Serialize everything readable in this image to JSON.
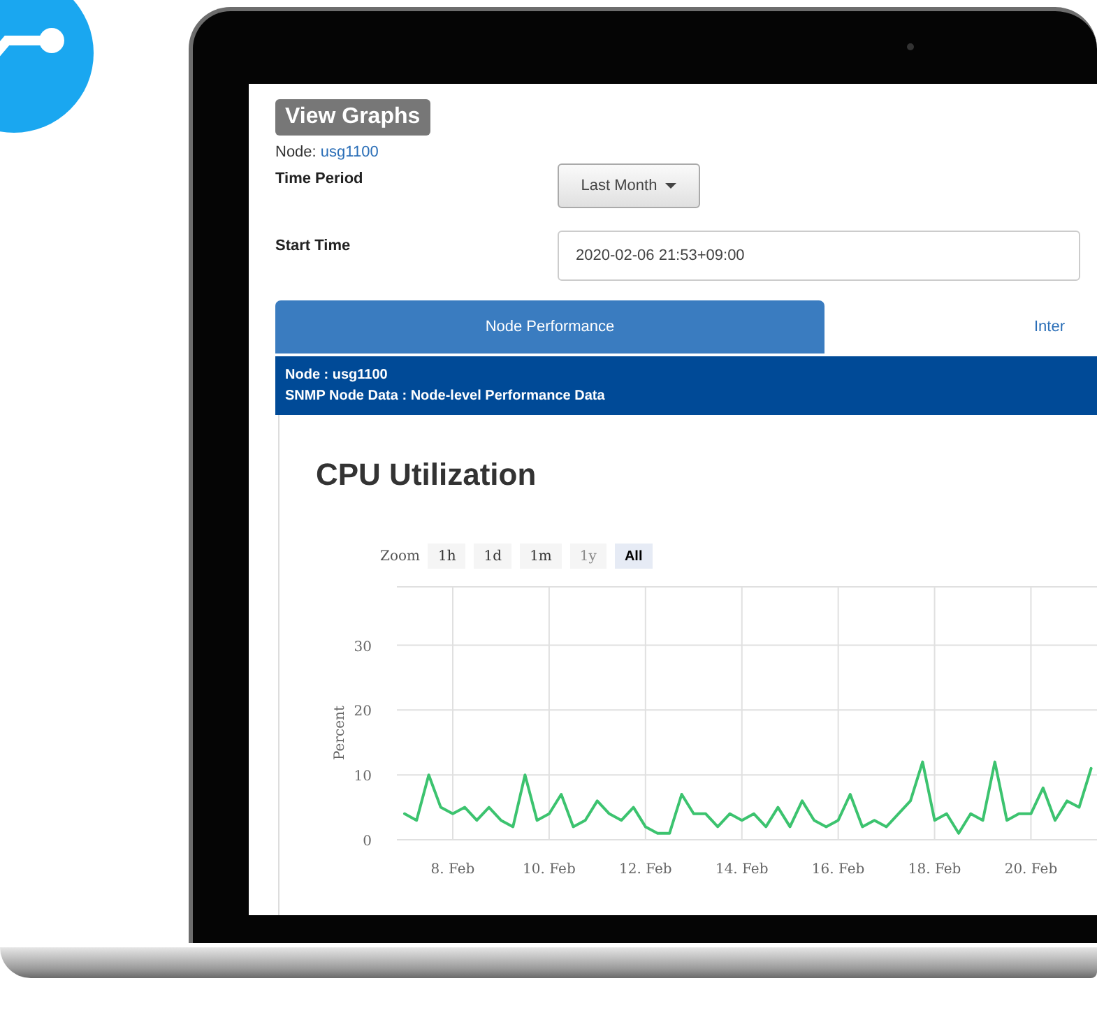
{
  "page": {
    "heading": "View Graphs",
    "node_label": "Node:",
    "node_link": "usg1100"
  },
  "form": [
    {
      "label": "Time Period",
      "kind": "dropdown",
      "value": "Last Month"
    },
    {
      "label": "Start Time",
      "kind": "text",
      "value": "2020-02-06 21:53+09:00"
    }
  ],
  "tabs": [
    {
      "label": "Node Performance",
      "selected": true
    },
    {
      "label": "Inter",
      "selected": false
    }
  ],
  "panel": {
    "lines": [
      "Node : usg1100",
      "SNMP Node Data : Node-level Performance Data"
    ]
  },
  "chart": {
    "zoom_label": "Zoom",
    "zoom_buttons": [
      {
        "label": "1h",
        "selected": false,
        "disabled": false
      },
      {
        "label": "1d",
        "selected": false,
        "disabled": false
      },
      {
        "label": "1m",
        "selected": false,
        "disabled": false
      },
      {
        "label": "1y",
        "selected": false,
        "disabled": true
      },
      {
        "label": "All",
        "selected": true,
        "disabled": false
      }
    ],
    "chart_data": {
      "type": "line",
      "title": "CPU Utilization",
      "ylabel": "Percent",
      "grid": true,
      "ylim": [
        0,
        39
      ],
      "yticks": [
        0,
        10,
        20,
        30
      ],
      "categories": [
        null,
        null,
        null,
        null,
        "8. Feb",
        null,
        null,
        null,
        null,
        null,
        null,
        null,
        "10. Feb",
        null,
        null,
        null,
        null,
        null,
        null,
        null,
        "12. Feb",
        null,
        null,
        null,
        null,
        null,
        null,
        null,
        "14. Feb",
        null,
        null,
        null,
        null,
        null,
        null,
        null,
        "16. Feb",
        null,
        null,
        null,
        null,
        null,
        null,
        null,
        "18. Feb",
        null,
        null,
        null,
        null,
        null,
        null,
        null,
        "20. Feb",
        null,
        null,
        null,
        null,
        null
      ],
      "series": [
        {
          "color": "#3cc36f",
          "values": [
            4,
            3,
            10,
            5,
            4,
            5,
            3,
            5,
            3,
            2,
            10,
            3,
            4,
            7,
            2,
            3,
            6,
            4,
            3,
            5,
            2,
            1,
            1,
            7,
            4,
            4,
            2,
            4,
            3,
            4,
            2,
            5,
            2,
            6,
            3,
            2,
            3,
            7,
            2,
            3,
            2,
            4,
            6,
            12,
            3,
            4,
            1,
            4,
            3,
            12,
            3,
            4,
            4,
            8,
            3,
            6,
            5,
            11
          ]
        }
      ]
    }
  }
}
